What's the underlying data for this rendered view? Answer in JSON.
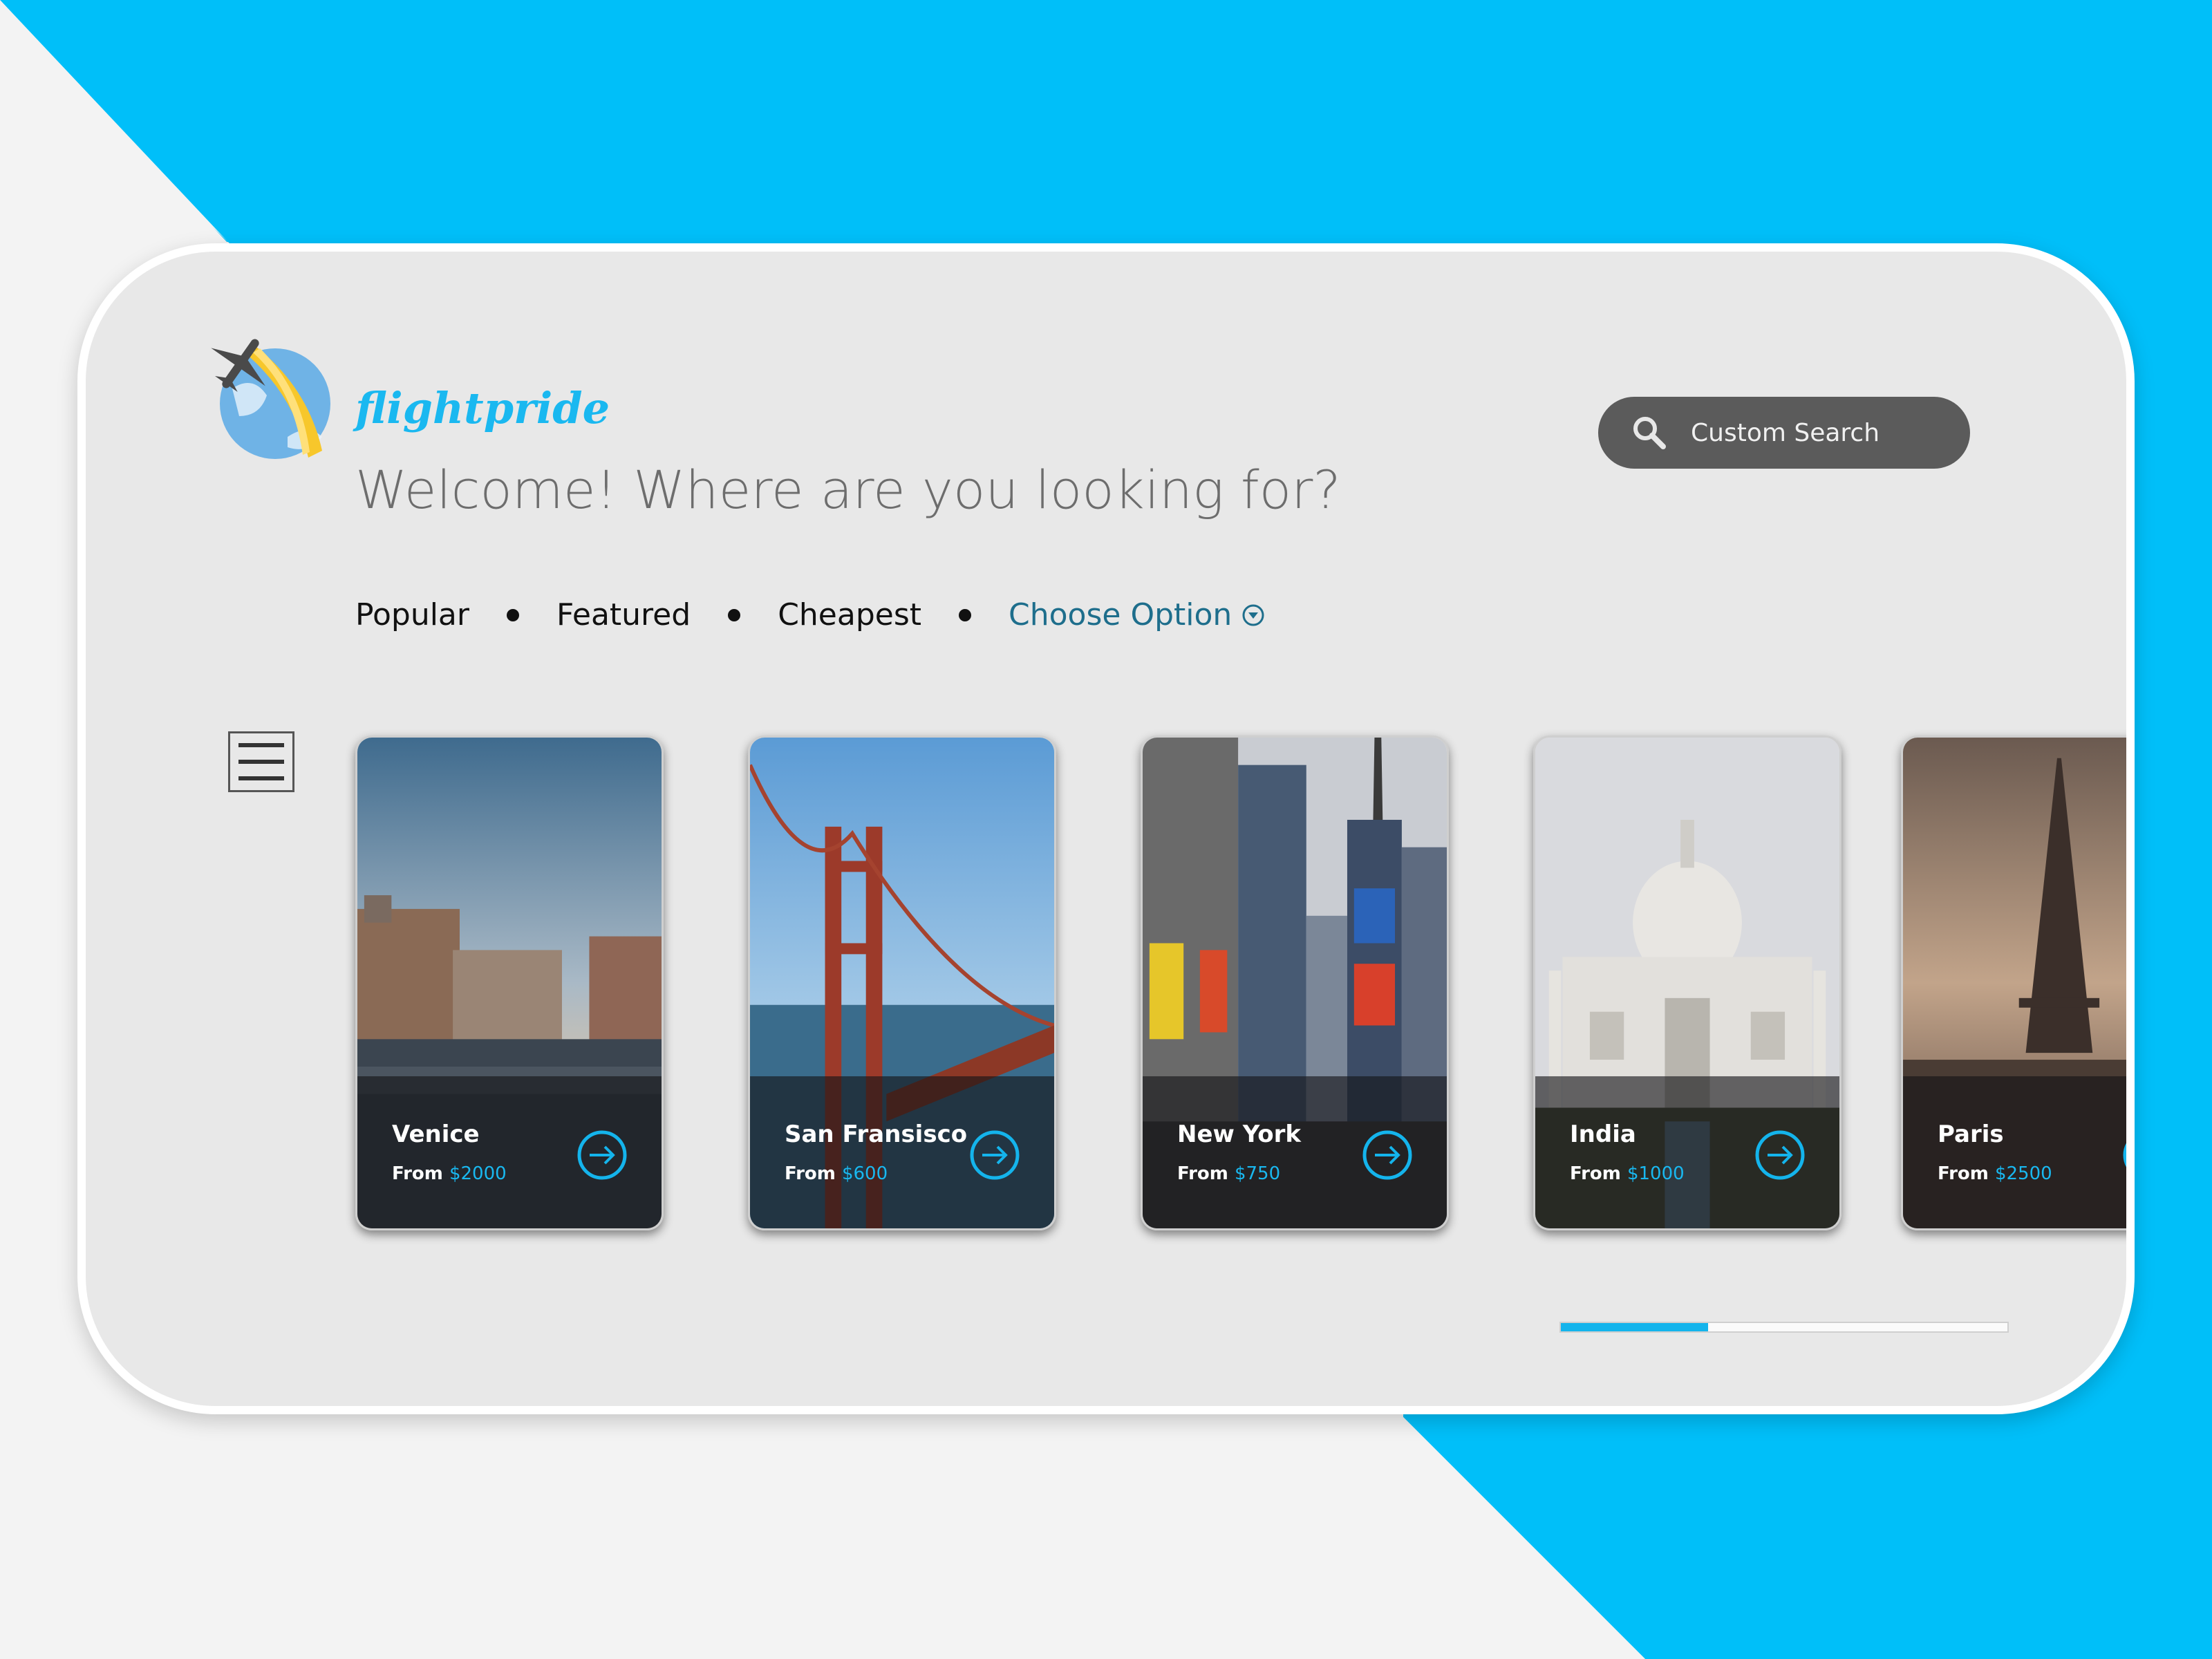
{
  "colors": {
    "accent": "#14b4ec",
    "panel_bg": "#e8e8e8",
    "search_bg": "#5b5b5b",
    "choose_option": "#1e6e8c"
  },
  "brand": {
    "name": "flightpride",
    "logo_icon": "plane-globe-icon"
  },
  "header": {
    "welcome": "Welcome! Where are you looking for?"
  },
  "search": {
    "label": "Custom Search",
    "icon": "search-icon"
  },
  "filters": {
    "popular": "Popular",
    "featured": "Featured",
    "cheapest": "Cheapest",
    "choose": "Choose Option"
  },
  "price_prefix": "From",
  "destinations": [
    {
      "name": "Venice",
      "price": "$2000"
    },
    {
      "name": "San Fransisco",
      "price": "$600"
    },
    {
      "name": "New York",
      "price": "$750"
    },
    {
      "name": "India",
      "price": "$1000"
    },
    {
      "name": "Paris",
      "price": "$2500"
    }
  ],
  "carousel": {
    "progress": 0.33
  }
}
